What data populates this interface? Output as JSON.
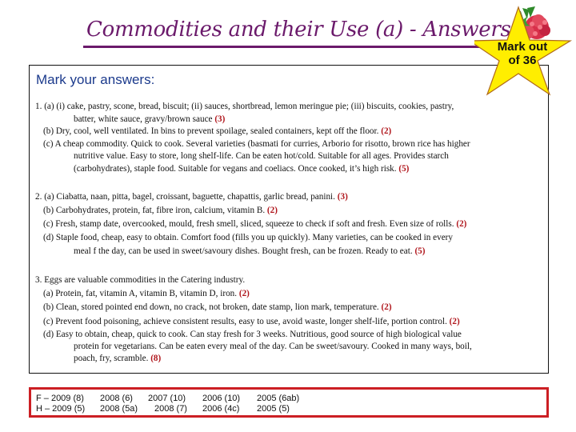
{
  "title": "Commodities and their Use (a) - Answers",
  "badge": {
    "line1": "Mark out",
    "line2": "of 36",
    "icon": "raspberry-icon",
    "shape": "star"
  },
  "heading": "Mark your answers:",
  "colors": {
    "title": "#6b1a6b",
    "heading": "#1b3a8c",
    "mark": "#b0161c",
    "refs_border": "#cc1f24",
    "star_fill": "#ffee00"
  },
  "questions": [
    {
      "lines": [
        {
          "text": "1. (a) (i) cake, pastry, scone, bread, biscuit;  (ii) sauces, shortbread, lemon meringue pie;  (iii) biscuits, cookies, pastry,",
          "mark": ""
        },
        {
          "text": "batter, white sauce, gravy/brown sauce ",
          "mark": "(3)"
        },
        {
          "text": "(b) Dry, cool, well ventilated. In bins to prevent spoilage, sealed containers, kept off the floor. ",
          "mark": "(2)"
        },
        {
          "text": "(c) A cheap commodity. Quick to cook. Several varieties (basmati for curries, Arborio for risotto, brown rice has higher",
          "mark": ""
        },
        {
          "text": "nutritive value. Easy to store, long shelf-life. Can be eaten hot/cold. Suitable for all ages. Provides starch",
          "mark": ""
        },
        {
          "text": "(carbohydrates), staple food. Suitable for vegans and coeliacs. Once cooked, it’s high risk. ",
          "mark": "(5)"
        }
      ]
    },
    {
      "lines": [
        {
          "text": "2. (a) Ciabatta, naan, pitta, bagel, croissant, baguette, chapattis, garlic bread, panini. ",
          "mark": "(3)"
        },
        {
          "text": "(b) Carbohydrates, protein, fat, fibre iron, calcium, vitamin B. ",
          "mark": "(2)"
        },
        {
          "text": "(c) Fresh, stamp date, overcooked, mould, fresh smell, sliced, squeeze to check if soft and fresh. Even size of rolls. ",
          "mark": "(2)"
        },
        {
          "text": "(d) Staple food, cheap, easy to obtain. Comfort food (fills you up quickly). Many varieties, can be cooked in every",
          "mark": ""
        },
        {
          "text": "meal f the day, can be used in sweet/savoury dishes. Bought fresh, can be frozen. Ready to eat. ",
          "mark": "(5)"
        }
      ]
    },
    {
      "lines": [
        {
          "text": "3. Eggs are valuable commodities in the Catering industry.",
          "mark": ""
        },
        {
          "text": "(a) Protein, fat, vitamin A, vitamin B, vitamin D, iron. ",
          "mark": "(2)"
        },
        {
          "text": "(b) Clean, stored pointed end down, no crack, not broken, date stamp, lion mark, temperature. ",
          "mark": "(2)"
        },
        {
          "text": "(c) Prevent food poisoning, achieve consistent results, easy to use, avoid waste, longer shelf-life, portion control. ",
          "mark": "(2)"
        },
        {
          "text": "(d) Easy to obtain, cheap, quick to cook. Can stay fresh for 3 weeks. Nutritious, good source of high biological value",
          "mark": ""
        },
        {
          "text": "protein for vegetarians. Can be eaten every meal of the day. Can be sweet/savoury. Cooked in many ways, boil,",
          "mark": ""
        },
        {
          "text": "poach, fry, scramble. ",
          "mark": "(8)"
        }
      ]
    }
  ],
  "references": {
    "foundation": [
      "F – 2009 (8)",
      "2008 (6)",
      "2007 (10)",
      "2006 (10)",
      "2005 (6ab)"
    ],
    "higher": [
      "H – 2009 (5)",
      "2008 (5a)",
      "2008 (7)",
      "2006 (4c)",
      "2005 (5)"
    ]
  }
}
